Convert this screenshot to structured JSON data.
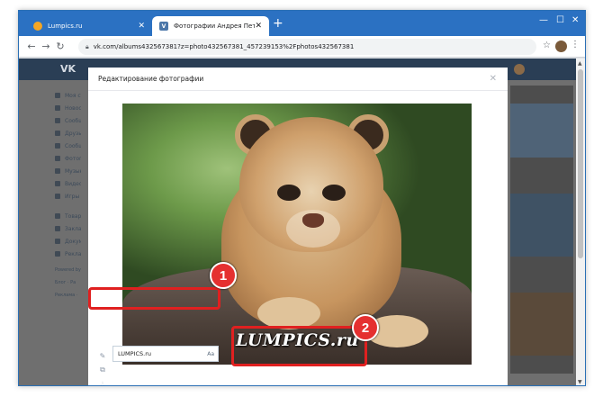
{
  "browser": {
    "tabs": [
      {
        "label": "Lumpics.ru",
        "active": false
      },
      {
        "label": "Фотографии Андрея Петрова ·",
        "active": true
      }
    ],
    "url": "vk.com/albums432567381?z=photo432567381_457239153%2Fphotos432567381"
  },
  "vk": {
    "logo": "VK",
    "sidebar": [
      {
        "label": "Моя стр",
        "icon": "home-icon"
      },
      {
        "label": "Новост",
        "icon": "news-icon"
      },
      {
        "label": "Сообщ",
        "icon": "messages-icon"
      },
      {
        "label": "Друзья",
        "icon": "friends-icon"
      },
      {
        "label": "Сообщ",
        "icon": "groups-icon"
      },
      {
        "label": "Фотог",
        "icon": "photos-icon"
      },
      {
        "label": "Музык",
        "icon": "music-icon"
      },
      {
        "label": "Видео",
        "icon": "video-icon"
      },
      {
        "label": "Игры",
        "icon": "games-icon"
      },
      {
        "label": "Товар",
        "icon": "market-icon"
      },
      {
        "label": "Заклад",
        "icon": "bookmarks-icon"
      },
      {
        "label": "Докум",
        "icon": "documents-icon"
      },
      {
        "label": "Рекла",
        "icon": "ads-icon"
      }
    ],
    "footer": [
      "Powered by",
      "Блог · Ра",
      "Реклама ·"
    ]
  },
  "modal": {
    "title": "Редактирование фотографии",
    "text_value": "LUMPICS.ru",
    "text_style_label": "Аа",
    "watermark": "LUMPICS.ru"
  },
  "annotations": {
    "badge1": "1",
    "badge2": "2",
    "color": "#e02020"
  },
  "colors": {
    "chrome_tab_strip": "#2b71c2",
    "vk_header": "#2a3e55",
    "vk_accent": "#4a76a8"
  }
}
